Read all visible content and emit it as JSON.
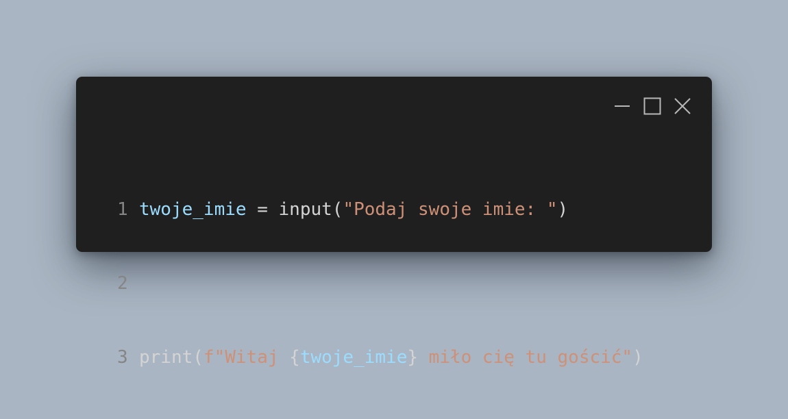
{
  "window": {
    "controls": {
      "minimize_icon": "minimize-icon",
      "maximize_icon": "maximize-icon",
      "close_icon": "close-icon"
    }
  },
  "code": {
    "lines": [
      {
        "number": "1",
        "tokens": [
          {
            "text": "twoje_imie",
            "kind": "var"
          },
          {
            "text": " = ",
            "kind": "plain"
          },
          {
            "text": "input(",
            "kind": "plain"
          },
          {
            "text": "\"Podaj swoje imie: \"",
            "kind": "str"
          },
          {
            "text": ")",
            "kind": "plain"
          }
        ]
      },
      {
        "number": "2",
        "tokens": []
      },
      {
        "number": "3",
        "tokens": [
          {
            "text": "print(",
            "kind": "plain"
          },
          {
            "text": "f\"Witaj ",
            "kind": "str"
          },
          {
            "text": "{",
            "kind": "plain"
          },
          {
            "text": "twoje_imie",
            "kind": "var"
          },
          {
            "text": "}",
            "kind": "plain"
          },
          {
            "text": " miło cię tu gościć\"",
            "kind": "str"
          },
          {
            "text": ")",
            "kind": "plain"
          }
        ]
      }
    ]
  },
  "colors": {
    "background": "#a9b5c2",
    "window": "#1f1f1f",
    "variable": "#9cdcfe",
    "string": "#ce9178",
    "plain": "#d4d4d4",
    "line_number": "#858585"
  }
}
